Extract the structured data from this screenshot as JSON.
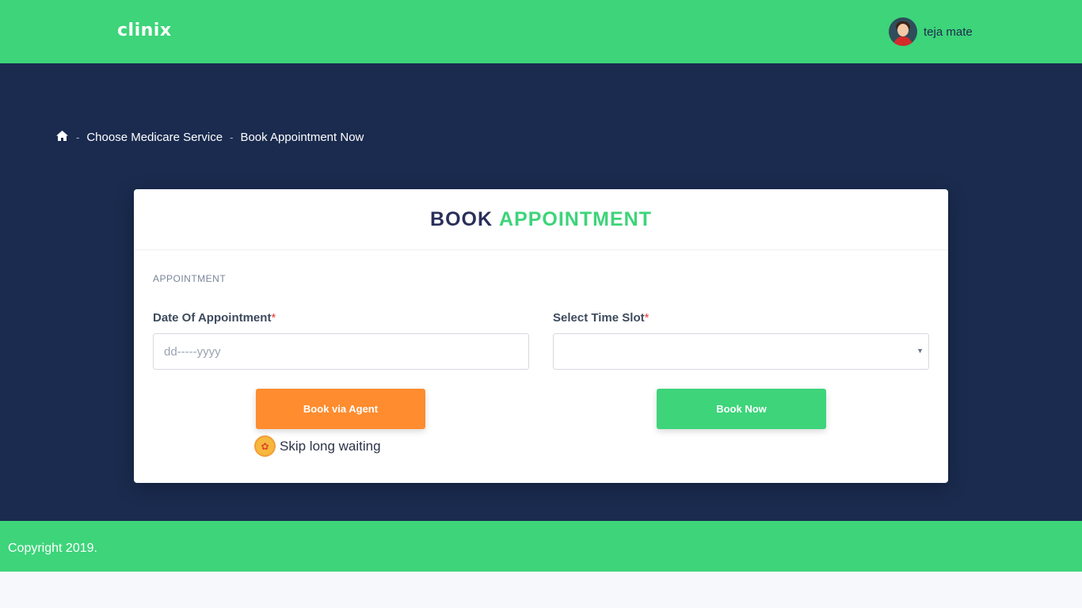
{
  "header": {
    "logo": "clinix",
    "user_name": "teja mate"
  },
  "breadcrumb": {
    "home_icon": "home-icon",
    "separator": "-",
    "items": [
      "Choose Medicare Service",
      "Book Appointment Now"
    ]
  },
  "card": {
    "title_part1": "BOOK",
    "title_part2": "APPOINTMENT",
    "section_label": "APPOINTMENT",
    "date_label": "Date Of Appointment",
    "date_placeholder": "dd-----yyyy",
    "time_label": "Select Time Slot",
    "time_value": "",
    "required_mark": "*",
    "book_agent_label": "Book via Agent",
    "book_now_label": "Book Now",
    "skip_text": "Skip long waiting"
  },
  "footer": {
    "copyright": "Copyright 2019."
  },
  "colors": {
    "brand_green": "#3dd47a",
    "navy": "#1a2b4f",
    "orange": "#ff8c2e",
    "title_dark": "#2a2f5a"
  }
}
